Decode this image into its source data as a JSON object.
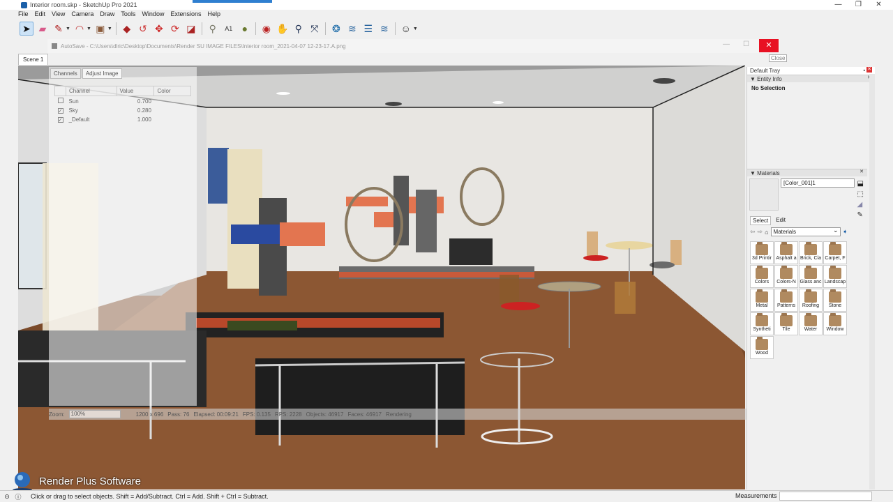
{
  "window": {
    "title": "Interior room.skp - SketchUp Pro 2021",
    "buttons": [
      "—",
      "❐",
      "✕"
    ]
  },
  "menu": [
    "File",
    "Edit",
    "View",
    "Camera",
    "Draw",
    "Tools",
    "Window",
    "Extensions",
    "Help"
  ],
  "toolbar_icons": [
    "select-icon",
    "eraser-icon",
    "pencil-icon",
    "arc-icon",
    "shape-icon",
    "push-pull-icon",
    "follow-me-icon",
    "move-icon",
    "rotate-icon",
    "scale-icon",
    "tape-icon",
    "text-icon",
    "paint-icon",
    "orbit-icon",
    "pan-icon",
    "zoom-icon",
    "zoom-extents-icon",
    "components-icon",
    "layers-icon",
    "styles-icon",
    "sections-icon",
    "account-icon"
  ],
  "render_window": {
    "title": "AutoSave - C:\\Users\\dlric\\Desktop\\Documents\\Render SU IMAGE FILES\\Interior room_2021-04-07 12-23-17.A.png",
    "close_tooltip": "Close",
    "tabs": [
      "Channels",
      "Adjust Image"
    ],
    "columns": [
      "Channel",
      "Value",
      "Color"
    ],
    "channels": [
      {
        "checked": false,
        "name": "Sun",
        "value": "0.700"
      },
      {
        "checked": true,
        "name": "Sky",
        "value": "0.280"
      },
      {
        "checked": true,
        "name": "_Default",
        "value": "1.000"
      }
    ],
    "status": {
      "zoom_label": "Zoom:",
      "zoom_value": "100%",
      "size": "1200 x 696",
      "pass": "Pass: 76",
      "elapsed": "Elapsed: 00:09:21",
      "fps": "FPS: 0.135",
      "rps": "RPS: 2228",
      "objects": "Objects: 46917",
      "faces": "Faces: 46917",
      "state": "Rendering"
    }
  },
  "scene_tab": "Scene 1",
  "tray": {
    "title": "Default Tray",
    "entity_info": "Entity Info",
    "no_selection": "No Selection",
    "materials": "Materials",
    "material_name": "[Color_001]1",
    "tabs": [
      "Select",
      "Edit"
    ],
    "library": "Materials",
    "items": [
      "3d Printir",
      "Asphalt a",
      "Brick, Cla",
      "Carpet, F",
      "Colors",
      "Colors-N",
      "Glass anc",
      "Landscap",
      "Metal",
      "Patterns",
      "Roofing",
      "Stone",
      "Syntheti",
      "Tile",
      "Water",
      "Window",
      "Wood"
    ]
  },
  "watermark": "Render Plus Software",
  "statusbar": {
    "text": "Click or drag to select objects. Shift = Add/Subtract. Ctrl = Add. Shift + Ctrl = Subtract.",
    "measurements": "Measurements"
  }
}
